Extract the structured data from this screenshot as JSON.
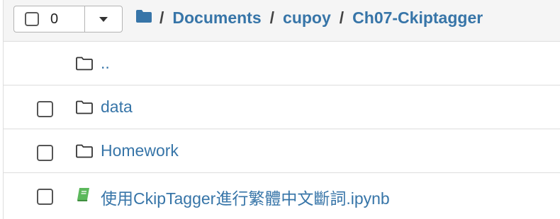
{
  "toolbar": {
    "selected_count": "0"
  },
  "breadcrumb": {
    "separator": "/",
    "items": [
      "Documents",
      "cupoy",
      "Ch07-Ckiptagger"
    ]
  },
  "files": [
    {
      "name": "..",
      "type": "folder",
      "has_checkbox": false
    },
    {
      "name": "data",
      "type": "folder",
      "has_checkbox": true
    },
    {
      "name": "Homework",
      "type": "folder",
      "has_checkbox": true
    },
    {
      "name": "使用CkipTagger進行繁體中文斷詞.ipynb",
      "type": "notebook",
      "has_checkbox": true
    }
  ],
  "colors": {
    "link": "#3775a8",
    "notebook_icon": "#5cb85c"
  }
}
